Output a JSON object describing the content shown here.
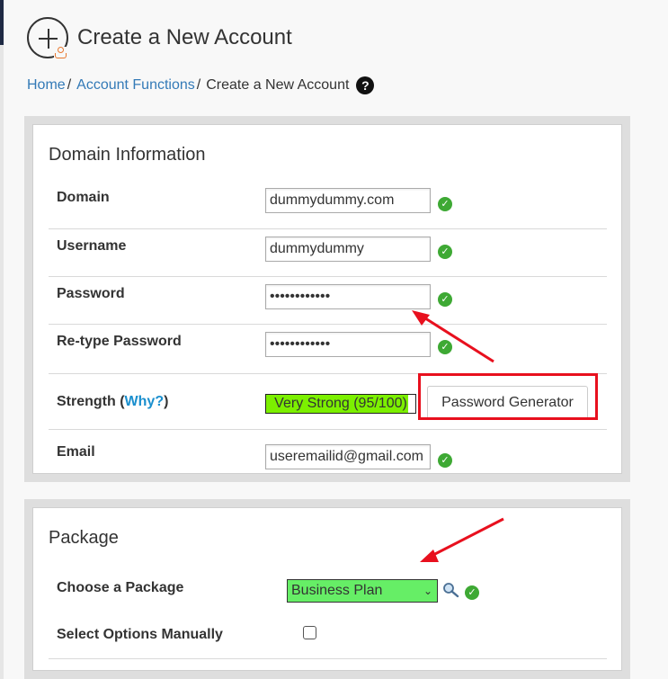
{
  "header": {
    "title": "Create a New Account",
    "icon": "add-account-icon"
  },
  "breadcrumb": {
    "items": [
      "Home",
      "Account Functions"
    ],
    "separator": "/",
    "current": "Create a New Account",
    "help_glyph": "?"
  },
  "domain_info": {
    "title": "Domain Information",
    "domain_label": "Domain",
    "domain_value": "dummydummy.com",
    "username_label": "Username",
    "username_value": "dummydummy",
    "password_label": "Password",
    "password_value": "••••••••••••",
    "retype_label": "Re-type Password",
    "retype_value": "••••••••••••",
    "strength_label": "Strength (",
    "strength_link": "Why?",
    "strength_close": ")",
    "strength_text": "Very Strong (95/100)",
    "strength_score": 95,
    "password_generator_label": "Password Generator",
    "email_label": "Email",
    "email_value": "useremailid@gmail.com",
    "valid_glyph": "✓"
  },
  "package": {
    "title": "Package",
    "choose_label": "Choose a Package",
    "selected_package": "Business Plan",
    "caret": "⌄",
    "manual_label": "Select Options Manually",
    "manual_checked": false
  },
  "colors": {
    "accent_link": "#337ab7",
    "valid_check": "#3ea934",
    "strength_fill": "#7cf000",
    "select_bg": "#66ee66",
    "annotation_red": "#e8101e"
  }
}
